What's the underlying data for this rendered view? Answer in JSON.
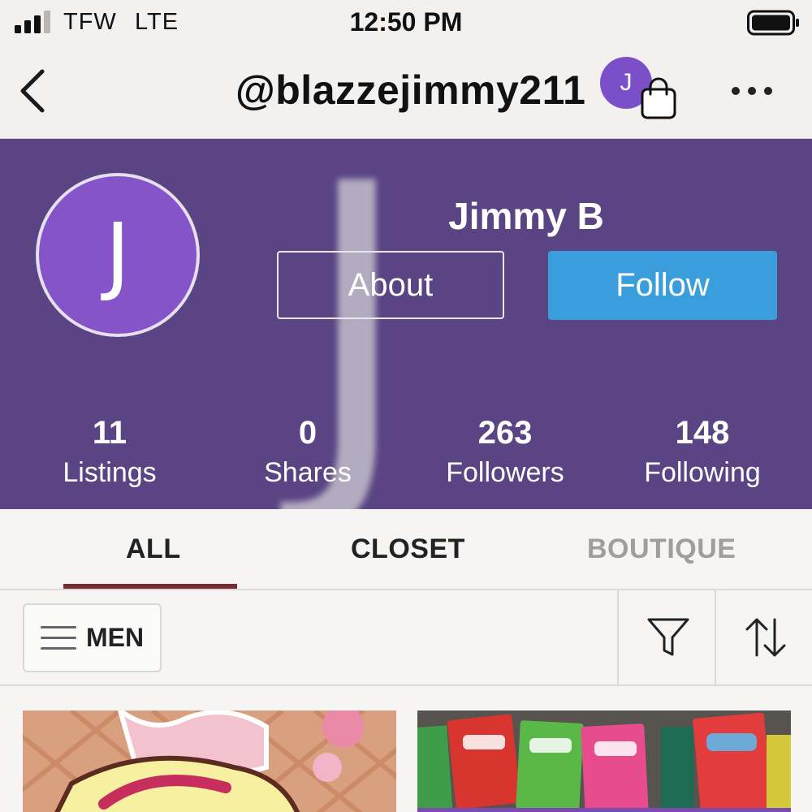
{
  "status_bar": {
    "carrier": "TFW",
    "network": "LTE",
    "time": "12:50 PM"
  },
  "header": {
    "username": "@blazzejimmy211",
    "avatar_initial": "J",
    "back_icon": "chevron-left-icon",
    "bag_icon": "shopping-bag-icon",
    "more_icon": "more-horizontal-icon"
  },
  "profile": {
    "avatar_initial": "J",
    "watermark_initial": "J",
    "display_name": "Jimmy B",
    "about_label": "About",
    "follow_label": "Follow",
    "stats": [
      {
        "value": "11",
        "label": "Listings"
      },
      {
        "value": "0",
        "label": "Shares"
      },
      {
        "value": "263",
        "label": "Followers"
      },
      {
        "value": "148",
        "label": "Following"
      }
    ]
  },
  "tabs": [
    {
      "label": "ALL",
      "active": true
    },
    {
      "label": "CLOSET",
      "active": false
    },
    {
      "label": "BOUTIQUE",
      "active": false
    }
  ],
  "filters": {
    "department_label": "MEN",
    "menu_icon": "hamburger-icon",
    "filter_icon": "filter-icon",
    "sort_icon": "sort-icon"
  },
  "listings": [
    {
      "image": "ice-cream-graphic"
    },
    {
      "image": "candy-assortment-photo"
    }
  ],
  "colors": {
    "banner": "#5a4483",
    "avatar": "#8654c9",
    "follow_button": "#3b9edc",
    "active_tab_underline": "#7a2a32",
    "inactive_tab_text": "#a09d9a"
  }
}
